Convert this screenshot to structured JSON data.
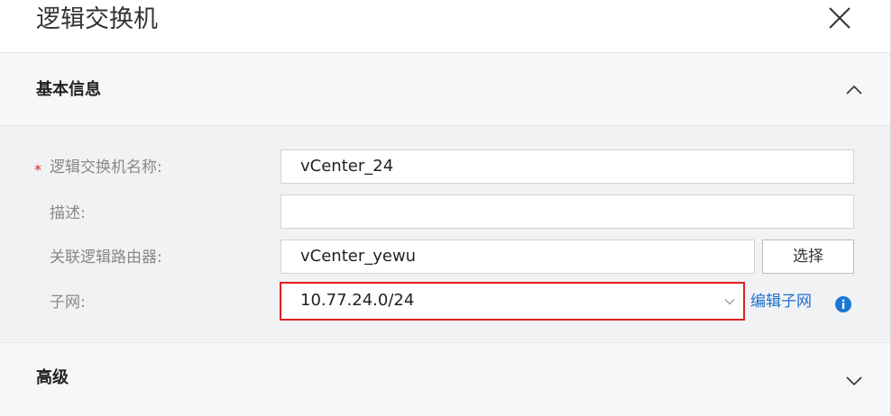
{
  "dialog": {
    "title": "逻辑交换机"
  },
  "sections": {
    "basic": {
      "title": "基本信息",
      "expanded": true
    },
    "advanced": {
      "title": "高级",
      "expanded": false
    }
  },
  "form": {
    "name": {
      "label": "逻辑交换机名称:",
      "required": true,
      "required_mark": "*",
      "value": "vCenter_24"
    },
    "description": {
      "label": "描述:",
      "value": ""
    },
    "router": {
      "label": "关联逻辑路由器:",
      "value": "vCenter_yewu",
      "select_label": "选择"
    },
    "subnet": {
      "label": "子网:",
      "value": "10.77.24.0/24",
      "edit_link": "编辑子网"
    }
  },
  "icons": {
    "close": "close-icon",
    "collapse": "chevron-up-icon",
    "expand": "chevron-down-icon",
    "info": "info-icon"
  },
  "colors": {
    "required_star": "#e0201f",
    "highlight_border": "#e0201f",
    "link": "#1f6fc9",
    "info_icon": "#1a78d2",
    "form_background": "#f1f2f4",
    "section_background": "#f6f7f9"
  }
}
